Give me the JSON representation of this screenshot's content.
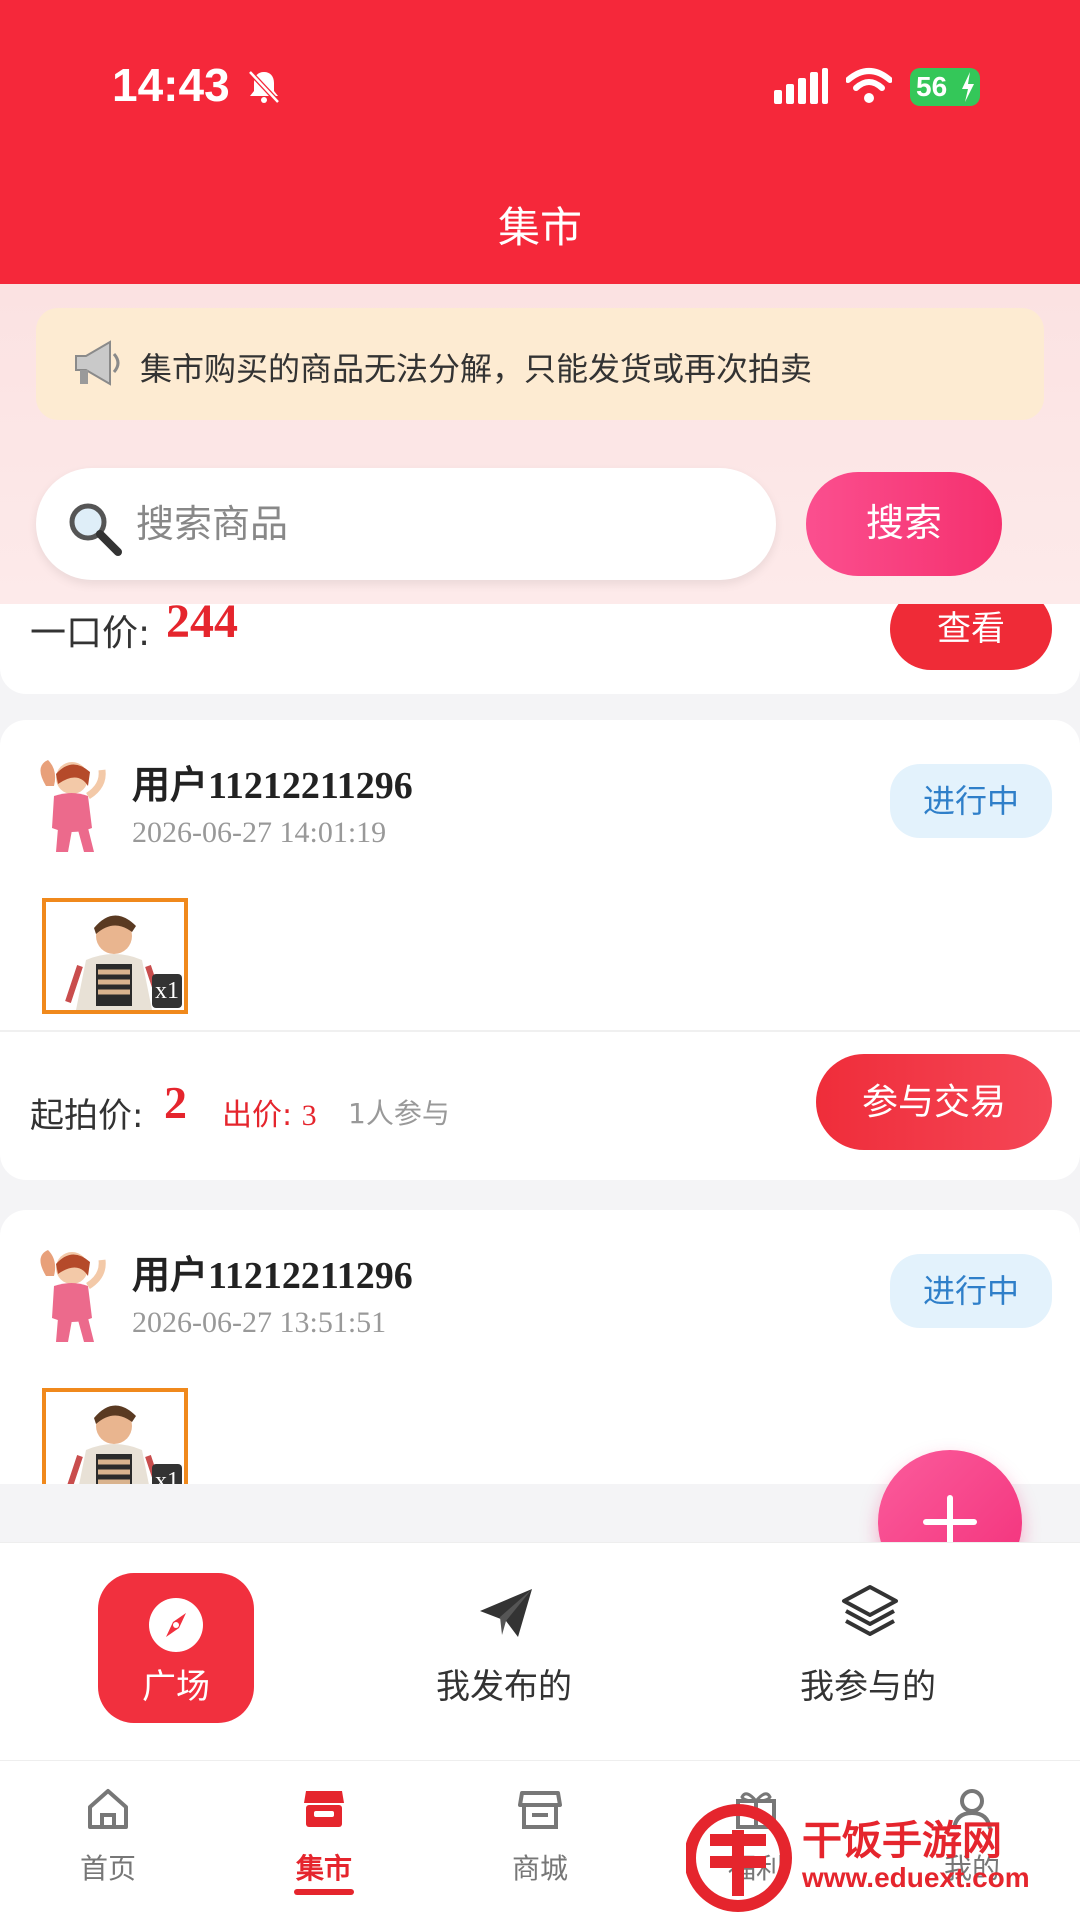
{
  "status_bar": {
    "time": "14:43",
    "battery": "56"
  },
  "header": {
    "title": "集市"
  },
  "notice": {
    "text": "集市购买的商品无法分解，只能发货或再次拍卖"
  },
  "search": {
    "placeholder": "搜索商品",
    "button_label": "搜索"
  },
  "partial_card": {
    "label": "一口价:",
    "price": "244",
    "button_label": "查看"
  },
  "listings": [
    {
      "user": "用户11212211296",
      "time": "2026-06-27 14:01:19",
      "status": "进行中",
      "quantity": "x1",
      "start_label": "起拍价:",
      "start_price": "2",
      "bid_label": "出价:",
      "bid_value": "3",
      "participants": "1人参与",
      "action_label": "参与交易"
    },
    {
      "user": "用户11212211296",
      "time": "2026-06-27 13:51:51",
      "status": "进行中",
      "quantity": "x1"
    }
  ],
  "segments": [
    {
      "label": "广场",
      "icon": "compass-icon",
      "active": true
    },
    {
      "label": "我发布的",
      "icon": "paper-plane-icon"
    },
    {
      "label": "我参与的",
      "icon": "layers-icon"
    }
  ],
  "tabs": [
    {
      "label": "首页",
      "icon": "home-icon"
    },
    {
      "label": "集市",
      "icon": "market-icon",
      "active": true
    },
    {
      "label": "商城",
      "icon": "store-icon"
    },
    {
      "label": "福利",
      "icon": "gift-icon"
    },
    {
      "label": "我的",
      "icon": "user-icon"
    }
  ],
  "watermark": {
    "name": "干饭手游网",
    "url": "www.eduext.com"
  },
  "colors": {
    "primary": "#f5283a",
    "accent_pink": "#f3307a",
    "status_blue": "#2f7fc9"
  }
}
